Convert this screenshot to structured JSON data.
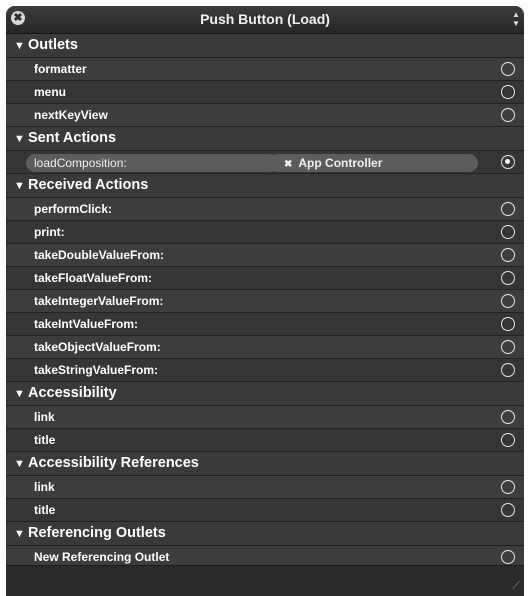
{
  "window": {
    "title": "Push Button (Load)",
    "close_icon": "✖",
    "popup_icon": "↕"
  },
  "sections": [
    {
      "title": "Outlets",
      "rows": [
        {
          "label": "formatter",
          "connected": false
        },
        {
          "label": "menu",
          "connected": false
        },
        {
          "label": "nextKeyView",
          "connected": false
        }
      ]
    },
    {
      "title": "Sent Actions",
      "rows": [
        {
          "label": "loadComposition:",
          "connected": true,
          "target": "App Controller"
        }
      ]
    },
    {
      "title": "Received Actions",
      "rows": [
        {
          "label": "performClick:",
          "connected": false
        },
        {
          "label": "print:",
          "connected": false
        },
        {
          "label": "takeDoubleValueFrom:",
          "connected": false
        },
        {
          "label": "takeFloatValueFrom:",
          "connected": false
        },
        {
          "label": "takeIntegerValueFrom:",
          "connected": false
        },
        {
          "label": "takeIntValueFrom:",
          "connected": false
        },
        {
          "label": "takeObjectValueFrom:",
          "connected": false
        },
        {
          "label": "takeStringValueFrom:",
          "connected": false
        }
      ]
    },
    {
      "title": "Accessibility",
      "rows": [
        {
          "label": "link",
          "connected": false
        },
        {
          "label": "title",
          "connected": false
        }
      ]
    },
    {
      "title": "Accessibility References",
      "rows": [
        {
          "label": "link",
          "connected": false
        },
        {
          "label": "title",
          "connected": false
        }
      ]
    },
    {
      "title": "Referencing Outlets",
      "rows": [
        {
          "label": "New Referencing Outlet",
          "connected": false
        }
      ]
    }
  ],
  "icons": {
    "section_toggle": "triangle-down-icon",
    "disconnect": "x-icon",
    "connection_point": "radio-circle-icon"
  },
  "colors": {
    "panel_bg": "#2b2b2b",
    "section_header_bg": "#3a3a3a",
    "row_alt_bg": "#3d3d3d",
    "connection_pill": "#5c5c5c"
  }
}
